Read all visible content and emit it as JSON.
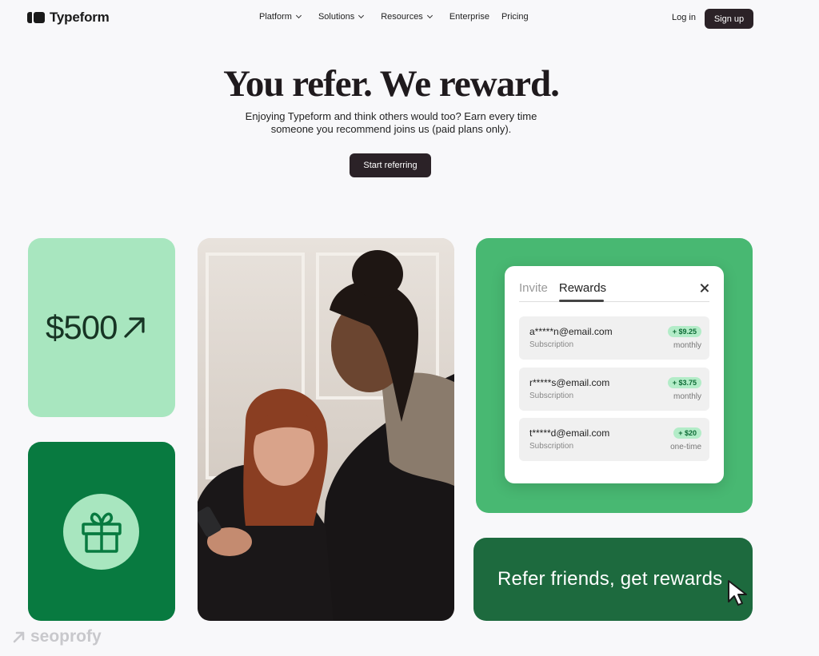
{
  "brand": {
    "name": "Typeform"
  },
  "nav": {
    "items": [
      {
        "label": "Platform",
        "has_dropdown": true
      },
      {
        "label": "Solutions",
        "has_dropdown": true
      },
      {
        "label": "Resources",
        "has_dropdown": true
      },
      {
        "label": "Enterprise",
        "has_dropdown": false
      },
      {
        "label": "Pricing",
        "has_dropdown": false
      }
    ],
    "login_label": "Log in",
    "signup_label": "Sign up"
  },
  "hero": {
    "title": "You refer. We reward.",
    "subtitle_line1": "Enjoying Typeform and think others would too? Earn every time",
    "subtitle_line2": "someone you recommend joins us (paid plans only).",
    "cta_label": "Start referring"
  },
  "cards": {
    "amount": "$500",
    "amount_icon": "arrow-up-right-icon",
    "gift_icon": "gift-icon",
    "rewards_panel": {
      "tabs": [
        "Invite",
        "Rewards"
      ],
      "active_tab": "Rewards",
      "rows": [
        {
          "email": "a*****n@email.com",
          "type": "Subscription",
          "amount": "+ $9.25",
          "frequency": "monthly"
        },
        {
          "email": "r*****s@email.com",
          "type": "Subscription",
          "amount": "+ $3.75",
          "frequency": "monthly"
        },
        {
          "email": "t*****d@email.com",
          "type": "Subscription",
          "amount": "+ $20",
          "frequency": "one-time"
        }
      ]
    },
    "refer_text": "Refer friends, get rewards"
  },
  "watermark": {
    "text": "seoprofy"
  },
  "colors": {
    "background": "#f8f8fa",
    "dark_button": "#2b2227",
    "mint": "#a8e6bf",
    "deep_green": "#087a40",
    "medium_green": "#48b872",
    "forest_green": "#1d6a3e"
  }
}
